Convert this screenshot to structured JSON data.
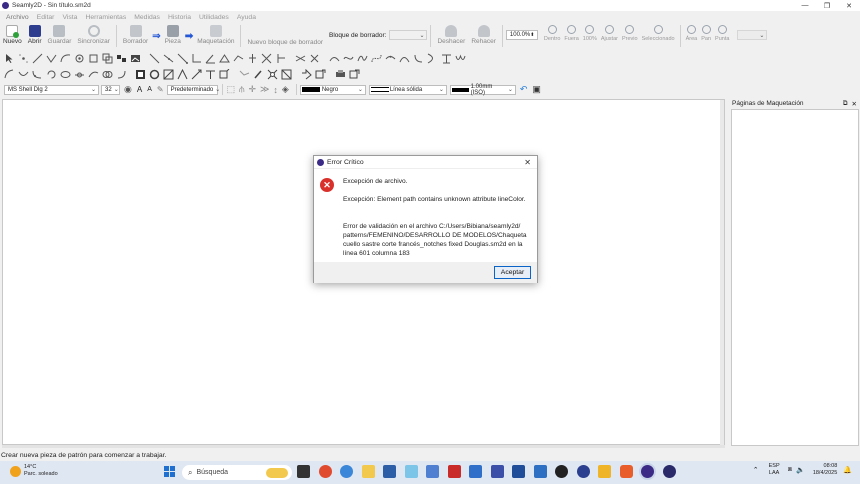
{
  "window": {
    "title": "Seamly2D - Sin título.sm2d",
    "controls": [
      "—",
      "❐",
      "✕"
    ]
  },
  "menu": [
    "Archivo",
    "Editar",
    "Vista",
    "Herramientas",
    "Medidas",
    "Historia",
    "Utilidades",
    "Ayuda"
  ],
  "toolbar": {
    "nuevo": "Nuevo",
    "abrir": "Abrir",
    "guardar": "Guardar",
    "sincronizar": "Sincronizar",
    "borrador": "Borrador",
    "pieza": "Pieza",
    "maquetacion": "Maquetación",
    "nuevo_bloque": "Nuevo bloque de borrador",
    "bloque_label": "Bloque de borrador:",
    "deshacer": "Deshacer",
    "rehacer": "Rehacer",
    "zoom_value": "100.0%",
    "dentro": "Dentro",
    "fuera": "Fuera",
    "z100": "100%",
    "ajustar": "Ajustar",
    "previo": "Previo",
    "seleccionado": "Seleccionado",
    "area": "Área",
    "pan": "Pan",
    "punta": "Punta"
  },
  "format_bar": {
    "font": "MS Shell Dlg 2",
    "size": "32",
    "label_style": "Predeterminado",
    "color": "Negro",
    "line_type": "Línea sólida",
    "line_weight": "1.00mm (ISO)"
  },
  "panel": {
    "title": "Páginas de Maquetación"
  },
  "status": "Crear nueva pieza de patrón para comenzar a trabajar.",
  "dialog": {
    "title": "Error Crítico",
    "heading": "Excepción de archivo.",
    "exception": "Excepción: Element path contains unknown attribute lineColor.",
    "detail_1": "Error de validación en el archivo C:/Users/Bibiana/seamly2d/",
    "detail_2": "patterns/FEMENINO/DESARROLLO DE MODELOS/Chaqueta",
    "detail_3": "cuello sastre corte francés_notches fixed Douglas.sm2d en la",
    "detail_4": "línea 601 columna 183",
    "ok": "Aceptar"
  },
  "taskbar": {
    "temp": "14°C",
    "weather": "Parc. soleado",
    "search_placeholder": "Búsqueda",
    "lang1": "ESP",
    "lang2": "LAA",
    "time": "08:08",
    "date": "18/4/2025"
  }
}
